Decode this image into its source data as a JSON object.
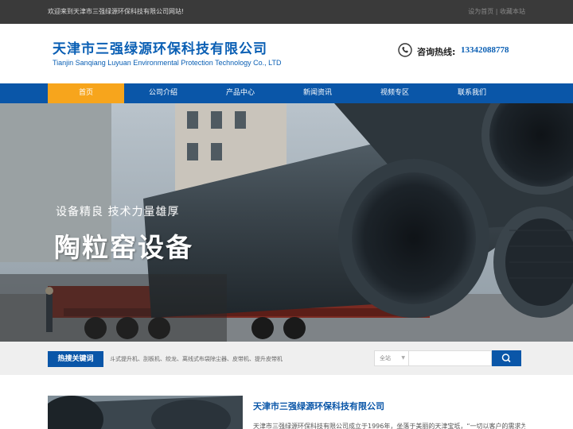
{
  "topbar": {
    "welcome": "欢迎来到天津市三强绿源环保科技有限公司网站!",
    "set_home": "设为首页",
    "separator": "|",
    "bookmark": "收藏本站"
  },
  "header": {
    "company_cn": "天津市三强绿源环保科技有限公司",
    "company_en": "Tianjin Sanqiang Luyuan Environmental Protection Technology Co., LTD",
    "hotline_label": "咨询热线:",
    "hotline_number": "13342088778",
    "phone_icon": "phone-icon"
  },
  "nav": {
    "items": [
      {
        "label": "首页"
      },
      {
        "label": "公司介绍"
      },
      {
        "label": "产品中心"
      },
      {
        "label": "新闻资讯"
      },
      {
        "label": "视频专区"
      },
      {
        "label": "联系我们"
      }
    ],
    "active_index": 0
  },
  "banner": {
    "slogan": "设备精良  技术力量雄厚",
    "title": "陶粒窑设备"
  },
  "search": {
    "hot_label": "热搜关键词",
    "hot_words": "斗式提升机、刮板机、绞龙、离线式布袋除尘器、皮带机、提升皮带机",
    "scope": "全站",
    "search_icon": "search-icon"
  },
  "about": {
    "title": "天津市三强绿源环保科技有限公司",
    "text": "天津市三强绿源环保科技有限公司成立于1996年，坐落于美丽的天津宝坻，“一切以客户的需求为"
  },
  "colors": {
    "brand_blue": "#0a56a8",
    "active_orange": "#f7a51c",
    "topbar": "#3a3a3a"
  }
}
